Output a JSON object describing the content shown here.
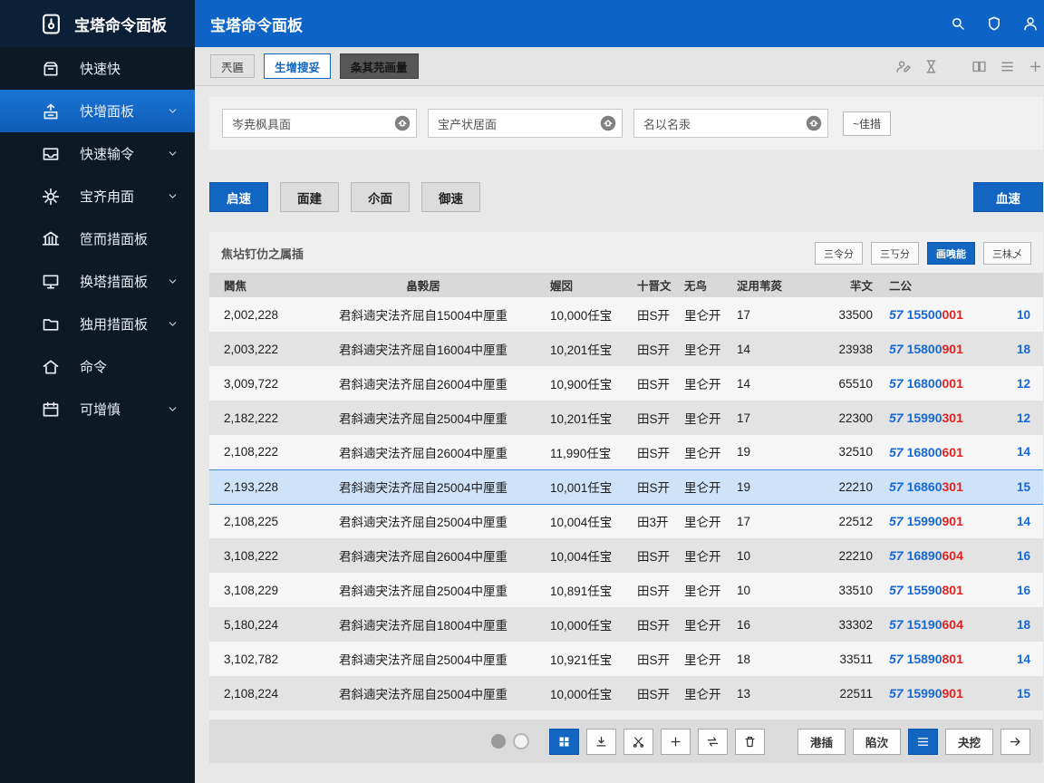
{
  "colors": {
    "accent_blue": "#1266c2",
    "header_blue": "#0d64c6",
    "sidebar_bg": "#0c1a26",
    "link_blue": "#1668d6",
    "link_red": "#e02222",
    "row_highlight": "#cfe3f8"
  },
  "sidebar": {
    "logo": "宝塔命令面板",
    "items": [
      {
        "label": "快速快",
        "icon": "box",
        "active": false,
        "chevron": false
      },
      {
        "label": "快增面板",
        "icon": "box-up",
        "active": true,
        "chevron": true
      },
      {
        "label": "快速输令",
        "icon": "inbox",
        "active": false,
        "chevron": true
      },
      {
        "label": "宝齐甪面",
        "icon": "gear",
        "active": false,
        "chevron": true
      },
      {
        "label": "笸而措面板",
        "icon": "bank",
        "active": false,
        "chevron": false
      },
      {
        "label": "换塔措面板",
        "icon": "monitor",
        "active": false,
        "chevron": true
      },
      {
        "label": "独用措面板",
        "icon": "folder",
        "active": false,
        "chevron": true
      },
      {
        "label": "命令",
        "icon": "home",
        "active": false,
        "chevron": false
      },
      {
        "label": "可增慎",
        "icon": "calendar",
        "active": false,
        "chevron": true
      }
    ]
  },
  "header": {
    "title": "宝塔命令面板",
    "icons": [
      "search",
      "shield",
      "user"
    ]
  },
  "tabs": [
    {
      "label": "兲匾",
      "style": "default"
    },
    {
      "label": "生增搜妥",
      "style": "active-outline"
    },
    {
      "label": "夈其芫画量",
      "style": "dark"
    }
  ],
  "toolbar": {
    "icons": [
      "user-edit",
      "hourglass",
      "columns",
      "list",
      "plus"
    ]
  },
  "filters": {
    "inputs": [
      {
        "value": "岑尭枫具面"
      },
      {
        "value": "宝产状居面"
      },
      {
        "value": "名以名汞"
      }
    ],
    "side_button": "~佳措"
  },
  "actions": {
    "left": [
      "启速",
      "面建",
      "尒面",
      "御速"
    ],
    "right": "血速"
  },
  "section": {
    "title": "焦坫钉仂之属插",
    "buttons": [
      {
        "label": "三令分",
        "active": false
      },
      {
        "label": "三丂分",
        "active": false
      },
      {
        "label": "画㖂能",
        "active": true
      },
      {
        "label": "三㭑乄",
        "active": false
      }
    ]
  },
  "icons": {
    "link_glyph": "57"
  },
  "table": {
    "columns": [
      "閪焦",
      "畠㝅居",
      "媉㘝",
      "十晋文",
      "无鸟",
      "浞用苇菼",
      "羋文",
      "二公",
      ""
    ],
    "highlighted_row": 5,
    "rows": [
      {
        "c1": "2,002,228",
        "c2": "君斜遖宊法齐屈自15004中厘重",
        "c3": "10,000任宝",
        "c4": "田S开",
        "c5": "里仑开",
        "c6": "17",
        "c7": "33500",
        "link_blue": "15500",
        "link_red": "001",
        "c9": "10"
      },
      {
        "c1": "2,003,222",
        "c2": "君斜遖宊法齐屈自16004中厘重",
        "c3": "10,201任宝",
        "c4": "田S开",
        "c5": "里仑开",
        "c6": "14",
        "c7": "23938",
        "link_blue": "15800",
        "link_red": "901",
        "c9": "18"
      },
      {
        "c1": "3,009,722",
        "c2": "君斜遖宊法齐屈自26004中厘重",
        "c3": "10,900任宝",
        "c4": "田S开",
        "c5": "里仑开",
        "c6": "14",
        "c7": "65510",
        "link_blue": "16800",
        "link_red": "001",
        "c9": "12"
      },
      {
        "c1": "2,182,222",
        "c2": "君斜遖宊法齐屈自25004中厘重",
        "c3": "10,201任宝",
        "c4": "田S开",
        "c5": "里仑开",
        "c6": "17",
        "c7": "22300",
        "link_blue": "15990",
        "link_red": "301",
        "c9": "12"
      },
      {
        "c1": "2,108,222",
        "c2": "君斜遖宊法齐屈自26004中厘重",
        "c3": "11,990任宝",
        "c4": "田S开",
        "c5": "里仑开",
        "c6": "19",
        "c7": "32510",
        "link_blue": "16800",
        "link_red": "601",
        "c9": "14"
      },
      {
        "c1": "2,193,228",
        "c2": "君斜遖宊法齐屈自25004中厘重",
        "c3": "10,001任宝",
        "c4": "田S开",
        "c5": "里仑开",
        "c6": "19",
        "c7": "22210",
        "link_blue": "16860",
        "link_red": "301",
        "c9": "15"
      },
      {
        "c1": "2,108,225",
        "c2": "君斜遖宊法齐屈自25004中厘重",
        "c3": "10,004任宝",
        "c4": "田3开",
        "c5": "里仑开",
        "c6": "17",
        "c7": "22512",
        "link_blue": "15990",
        "link_red": "901",
        "c9": "14"
      },
      {
        "c1": "3,108,222",
        "c2": "君斜遖宊法齐屈自26004中厘重",
        "c3": "10,004任宝",
        "c4": "田S开",
        "c5": "里仑开",
        "c6": "10",
        "c7": "22210",
        "link_blue": "16890",
        "link_red": "604",
        "c9": "16"
      },
      {
        "c1": "3,108,229",
        "c2": "君斜遖宊法齐屈自25004中厘重",
        "c3": "10,891任宝",
        "c4": "田S开",
        "c5": "里仑开",
        "c6": "10",
        "c7": "33510",
        "link_blue": "15590",
        "link_red": "801",
        "c9": "16"
      },
      {
        "c1": "5,180,224",
        "c2": "君斜遖宊法齐屈自18004中厘重",
        "c3": "10,000任宝",
        "c4": "田S开",
        "c5": "里仑开",
        "c6": "16",
        "c7": "33302",
        "link_blue": "15190",
        "link_red": "604",
        "c9": "18"
      },
      {
        "c1": "3,102,782",
        "c2": "君斜遖宊法齐屈自25004中厘重",
        "c3": "10,921任宝",
        "c4": "田S开",
        "c5": "里仑开",
        "c6": "18",
        "c7": "33511",
        "link_blue": "15890",
        "link_red": "801",
        "c9": "14"
      },
      {
        "c1": "2,108,224",
        "c2": "君斜遖宊法齐屈自25004中厘重",
        "c3": "10,000任宝",
        "c4": "田S开",
        "c5": "里仑开",
        "c6": "13",
        "c7": "22511",
        "link_blue": "15990",
        "link_red": "901",
        "c9": "15"
      }
    ]
  },
  "footer": {
    "buttons": [
      {
        "kind": "icon",
        "icon": "grid",
        "active": true
      },
      {
        "kind": "icon",
        "icon": "download",
        "active": false
      },
      {
        "kind": "icon",
        "icon": "cut",
        "active": false
      },
      {
        "kind": "icon",
        "icon": "plus",
        "active": false
      },
      {
        "kind": "icon",
        "icon": "swap",
        "active": false
      },
      {
        "kind": "icon",
        "icon": "trash",
        "active": false
      },
      {
        "kind": "text",
        "label": "港插",
        "active": false
      },
      {
        "kind": "text",
        "label": "陷㳄",
        "active": false
      },
      {
        "kind": "icon",
        "icon": "list",
        "active": true
      },
      {
        "kind": "text",
        "label": "夬挖",
        "active": false
      },
      {
        "kind": "icon",
        "icon": "arrow-right",
        "active": false
      }
    ]
  }
}
